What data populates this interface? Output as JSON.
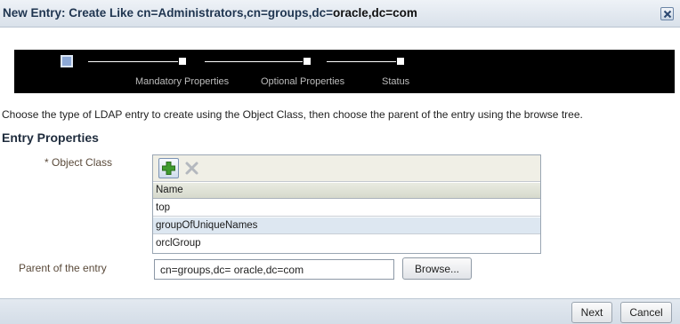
{
  "dialog": {
    "title_prefix": "New Entry: Create Like cn=Administrators,cn=groups,dc=",
    "title_host": "oracle,dc=com",
    "close_icon": "close-icon"
  },
  "train": {
    "steps": [
      {
        "label": "",
        "state": "current"
      },
      {
        "label": "Mandatory Properties",
        "state": "pending"
      },
      {
        "label": "Optional Properties",
        "state": "pending"
      },
      {
        "label": "Status",
        "state": "pending"
      }
    ]
  },
  "instructions": "Choose the type of LDAP entry to create using the Object Class, then choose the parent of the entry using the browse tree.",
  "section_title": "Entry Properties",
  "object_class": {
    "required_mark": "*",
    "label": "Object Class",
    "toolbar": {
      "add_icon": "add-icon",
      "remove_icon": "remove-icon"
    },
    "column_header": "Name",
    "rows": [
      "top",
      "groupOfUniqueNames",
      "orclGroup"
    ]
  },
  "parent": {
    "label": "Parent of the entry",
    "value": "cn=groups,dc= oracle,dc=com",
    "browse_label": "Browse..."
  },
  "footer": {
    "next_label": "Next",
    "cancel_label": "Cancel"
  }
}
